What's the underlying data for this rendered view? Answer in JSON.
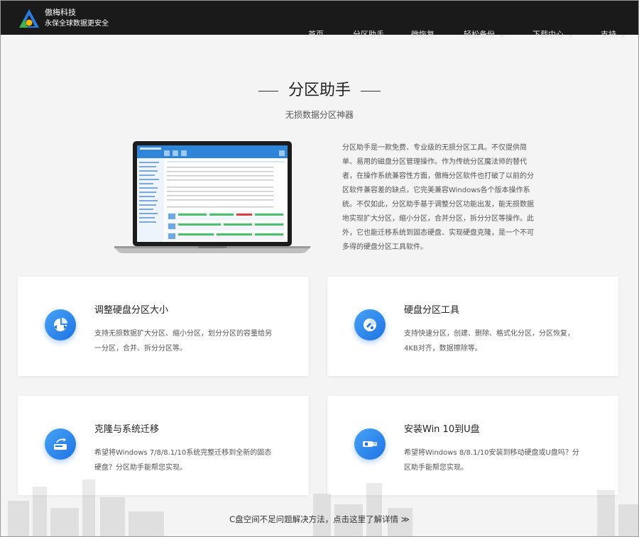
{
  "brand": {
    "name": "傲梅科技",
    "tagline": "永保全球数据更安全"
  },
  "nav": {
    "items": [
      {
        "label": "首页",
        "dropdown": false
      },
      {
        "label": "分区助手",
        "dropdown": false
      },
      {
        "label": "微恢复",
        "dropdown": false
      },
      {
        "label": "轻松备份",
        "dropdown": true
      },
      {
        "label": "下载中心",
        "dropdown": true
      },
      {
        "label": "支持",
        "dropdown": true
      }
    ],
    "chevron": "chevron-down-icon"
  },
  "hero": {
    "title": "分区助手",
    "subtitle": "无损数据分区神器",
    "description": "分区助手是一款免费、专业级的无损分区工具。不仅提供简单、易用的磁盘分区管理操作。作为传统分区魔法师的替代者，在操作系统兼容性方面，傲梅分区软件也打破了以前的分区软件兼容差的缺点，它完美兼容Windows各个版本操作系统。不仅如此，分区助手基于调整分区功能出发，能无损数据地实现扩大分区，缩小分区，合并分区，拆分分区等操作。此外，它也能迁移系统到固态硬盘、实现硬盘克隆，是一个不可多得的硬盘分区工具软件。"
  },
  "features": [
    {
      "title": "调整硬盘分区大小",
      "description": "支持无损数据扩大分区、缩小分区，划分分区的容量给另一分区，合并、拆分分区等。",
      "icon": "resize-partition-icon"
    },
    {
      "title": "硬盘分区工具",
      "description": "支持快速分区，创建、删除、格式化分区，分区恢复，4KB对齐，数据擦除等。",
      "icon": "partition-tool-icon"
    },
    {
      "title": "克隆与系统迁移",
      "description": "希望将Windows 7/8/8.1/10系统完整迁移到全新的固态硬盘？分区助手能帮您实现。",
      "icon": "migrate-disk-icon"
    },
    {
      "title": "安装Win 10到U盘",
      "description": "希望将Windows 8/8.1/10安装到移动硬盘或U盘吗？分区助手能帮您实现。",
      "icon": "usb-drive-icon"
    }
  ],
  "footer_link": {
    "label": "C盘空间不足问题解决方法，点击这里了解详情 ≫"
  },
  "colors": {
    "nav_bg": "#1a1a1a",
    "accent": "#1e73e3",
    "page_bg": "#f4f4f4"
  }
}
